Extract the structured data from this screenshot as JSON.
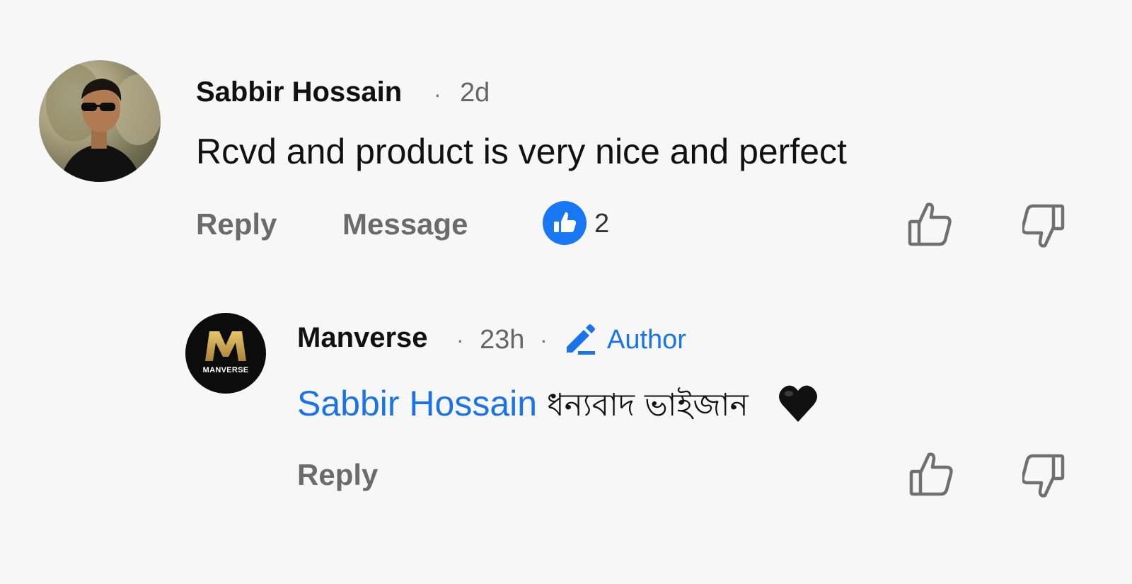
{
  "comment": {
    "author": "Sabbir Hossain",
    "time": "2d",
    "text": "Rcvd and product is very nice and perfect",
    "actions": {
      "reply": "Reply",
      "message": "Message",
      "reaction_count": "2"
    }
  },
  "reply": {
    "author": "Manverse",
    "time": "23h",
    "author_badge": "Author",
    "mention": "Sabbir Hossain",
    "text": "ধন্যবাদ ভাইজান",
    "emoji": "black-heart",
    "actions": {
      "reply": "Reply"
    },
    "avatar_text": "MANVERSE",
    "avatar_letter": "M"
  },
  "colors": {
    "accent_blue": "#1a73e8",
    "reaction_blue": "#1877f2",
    "muted_text": "#6b6b6b",
    "gold": "#c9a24a"
  }
}
